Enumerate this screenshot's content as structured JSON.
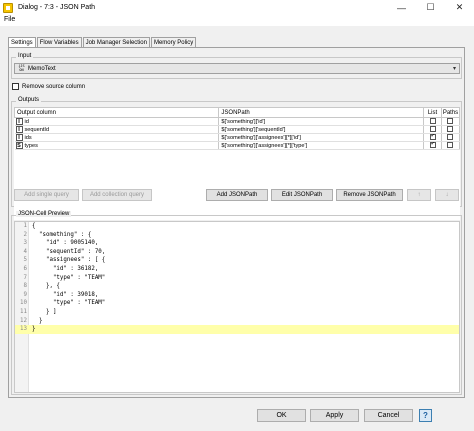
{
  "window": {
    "title": "Dialog - 7:3 - JSON Path",
    "minimize": "—",
    "maximize": "☐",
    "close": "✕"
  },
  "menu": {
    "file": "File"
  },
  "tabs": [
    {
      "label": "Settings"
    },
    {
      "label": "Flow Variables"
    },
    {
      "label": "Job Manager Selection"
    },
    {
      "label": "Memory Policy"
    }
  ],
  "input": {
    "group_label": "Input",
    "type_icon_top": "{JS",
    "type_icon_bottom": "ON",
    "column": "MemoText",
    "dropdown_arrow": "▾"
  },
  "remove_source": {
    "label": "Remove source column",
    "checked": false
  },
  "outputs": {
    "group_label": "Outputs",
    "headers": {
      "output_column": "Output column",
      "jsonpath": "JSONPath",
      "list": "List",
      "paths": "Paths"
    },
    "rows": [
      {
        "type": "I",
        "name": "id",
        "path": "$['something']['id']",
        "list": false,
        "paths": false
      },
      {
        "type": "I",
        "name": "sequentId",
        "path": "$['something']['sequentId']",
        "list": false,
        "paths": false
      },
      {
        "type": "I",
        "name": "ids",
        "path": "$['something']['assignees'][*]['id']",
        "list": true,
        "paths": false
      },
      {
        "type": "S",
        "name": "types",
        "path": "$['something']['assignees'][*]['type']",
        "list": true,
        "paths": false
      }
    ],
    "buttons": {
      "add_single": "Add single query",
      "add_collection": "Add collection query",
      "add_jsonpath": "Add JSONPath",
      "edit_jsonpath": "Edit JSONPath",
      "remove_jsonpath": "Remove JSONPath",
      "up": "↑",
      "down": "↓"
    }
  },
  "preview": {
    "group_label": "JSON-Cell Preview",
    "lines": [
      {
        "n": "1",
        "code": "{"
      },
      {
        "n": "2",
        "code": "  \"something\" : {"
      },
      {
        "n": "3",
        "code": "    \"id\" : 9005140,"
      },
      {
        "n": "4",
        "code": "    \"sequentId\" : 70,"
      },
      {
        "n": "5",
        "code": "    \"assignees\" : [ {"
      },
      {
        "n": "6",
        "code": "      \"id\" : 36182,"
      },
      {
        "n": "7",
        "code": "      \"type\" : \"TEAM\""
      },
      {
        "n": "8",
        "code": "    }, {"
      },
      {
        "n": "9",
        "code": "      \"id\" : 39018,"
      },
      {
        "n": "10",
        "code": "      \"type\" : \"TEAM\""
      },
      {
        "n": "11",
        "code": "    } ]"
      },
      {
        "n": "12",
        "code": "  }"
      },
      {
        "n": "13",
        "code": "}"
      }
    ],
    "highlight_line": 13
  },
  "footer": {
    "ok": "OK",
    "apply": "Apply",
    "cancel": "Cancel",
    "help": "?"
  }
}
